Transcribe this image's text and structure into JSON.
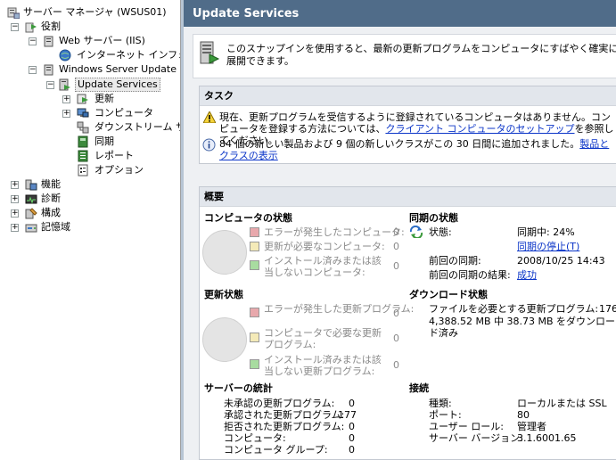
{
  "tree": {
    "items": [
      {
        "label": "サーバー マネージャ (WSUS01)",
        "icon": "server-manager-icon"
      },
      {
        "label": "役割",
        "icon": "roles-icon"
      },
      {
        "label": "Web サーバー (IIS)",
        "icon": "web-server-icon"
      },
      {
        "label": "インターネット インフォメ",
        "icon": "iis-manager-icon"
      },
      {
        "label": "Windows Server Update S",
        "icon": "wsus-role-icon"
      },
      {
        "label": "Update Services",
        "icon": "update-services-icon"
      },
      {
        "label": "更新",
        "icon": "updates-icon"
      },
      {
        "label": "コンピュータ",
        "icon": "computers-icon"
      },
      {
        "label": "ダウンストリーム サー",
        "icon": "downstream-servers-icon"
      },
      {
        "label": "同期",
        "icon": "sync-icon"
      },
      {
        "label": "レポート",
        "icon": "reports-icon"
      },
      {
        "label": "オプション",
        "icon": "options-icon"
      },
      {
        "label": "機能",
        "icon": "features-icon"
      },
      {
        "label": "診断",
        "icon": "diagnostics-icon"
      },
      {
        "label": "構成",
        "icon": "configuration-icon"
      },
      {
        "label": "記憶域",
        "icon": "storage-icon"
      }
    ]
  },
  "header": {
    "title": "Update Services"
  },
  "intro": {
    "text": "このスナップインを使用すると、最新の更新プログラムをコンピュータにすばやく確実に展開できます。"
  },
  "tasks": {
    "title": "タスク",
    "warning_text": "現在、更新プログラムを受信するように登録されているコンピュータはありません。コンピュータを登録する方法については、",
    "warning_link": "クライアント コンピュータのセットアップ",
    "warning_suffix": "を参照してください。",
    "info_text": "84 個の新しい製品および 9 個の新しいクラスがこの 30 日間に追加されました。",
    "info_link": "製品とクラスの表示"
  },
  "overview": {
    "title": "概要",
    "computer_status": {
      "title": "コンピュータの状態",
      "rows": [
        {
          "label": "エラーが発生したコンピュータ:",
          "value": "0",
          "color": "#e8a8ac"
        },
        {
          "label": "更新が必要なコンピュータ:",
          "value": "0",
          "color": "#f4eab8"
        },
        {
          "label": "インストール済みまたは該当しないコンピュータ:",
          "value": "0",
          "color": "#a8dca0"
        }
      ]
    },
    "update_status": {
      "title": "更新状態",
      "rows": [
        {
          "label": "エラーが発生した更新プログラム:",
          "value": "0",
          "color": "#e8a8ac"
        },
        {
          "label": "コンピュータで必要な更新プログラム:",
          "value": "0",
          "color": "#f4eab8"
        },
        {
          "label": "インストール済みまたは該当しない更新プログラム:",
          "value": "0",
          "color": "#a8dca0"
        }
      ]
    },
    "sync_status": {
      "title": "同期の状態",
      "state_label": "状態:",
      "state_value": "同期中: 24%",
      "stop_link": "同期の停止(T)",
      "last_sync_label": "前回の同期:",
      "last_sync_value": "2008/10/25 14:43",
      "last_result_label": "前回の同期の結果:",
      "last_result_value": "成功"
    },
    "download_status": {
      "title": "ダウンロード状態",
      "needed_label": "ファイルを必要とする更新プログラム:",
      "needed_value": "176",
      "progress_text": "4,388.52 MB 中 38.73 MB をダウンロード済み"
    },
    "server_stats": {
      "title": "サーバーの統計",
      "rows": [
        {
          "label": "未承認の更新プログラム:",
          "value": "0"
        },
        {
          "label": "承認された更新プログラム:",
          "value": "177"
        },
        {
          "label": "拒否された更新プログラム:",
          "value": "0"
        },
        {
          "label": "コンピュータ:",
          "value": "0"
        },
        {
          "label": "コンピュータ グループ:",
          "value": "0"
        }
      ]
    },
    "connection": {
      "title": "接続",
      "rows": [
        {
          "label": "種類:",
          "value": "ローカルまたは SSL"
        },
        {
          "label": "ポート:",
          "value": "80"
        },
        {
          "label": "ユーザー ロール:",
          "value": "管理者"
        },
        {
          "label": "サーバー バージョン:",
          "value": "3.1.6001.65"
        }
      ]
    }
  }
}
